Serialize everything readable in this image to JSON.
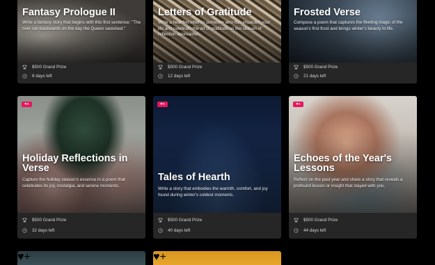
{
  "cards": [
    {
      "title": "Fantasy Prologue II",
      "description": "Write a fantasy story that begins with this first sentence: \"The river ran backwards on the day the Queen vanished.\"",
      "prize": "$500 Grand Prize",
      "days": "8 days left"
    },
    {
      "title": "Letters of Gratitude",
      "description": "Write a heartfelt letter to someone who has impacted your life and celebrate the art of gratitude as the season of reflection approaches.",
      "prize": "$500 Grand Prize",
      "days": "12 days left"
    },
    {
      "title": "Frosted Verse",
      "description": "Compose a poem that captures the fleeting magic of the season's first frost and brings winter's beauty to life.",
      "prize": "$500 Grand Prize",
      "days": "21 days left"
    },
    {
      "badge": "♥+",
      "title": "Holiday Reflections in Verse",
      "description": "Capture the holiday season's essence in a poem that celebrates its joy, nostalgia, and serene moments.",
      "prize": "$500 Grand Prize",
      "days": "32 days left"
    },
    {
      "badge": "♥+",
      "title": "Tales of Hearth",
      "description": "Write a story that embodies the warmth, comfort, and joy found during winter's coldest moments.",
      "prize": "$500 Grand Prize",
      "days": "40 days left"
    },
    {
      "badge": "♥+",
      "title": "Echoes of the Year's Lessons",
      "description": "Reflect on the past year and share a story that reveals a profound lesson or insight that stayed with you.",
      "prize": "$500 Grand Prize",
      "days": "44 days left"
    }
  ],
  "partial_cards": [
    {
      "badge": "♥+"
    },
    {
      "badge": "♥+"
    }
  ],
  "colors": {
    "page_background": "#000000",
    "card_footer": "#262626",
    "badge": "#e8175d"
  },
  "icons": {
    "prize": "trophy-icon",
    "deadline": "clock-icon"
  }
}
